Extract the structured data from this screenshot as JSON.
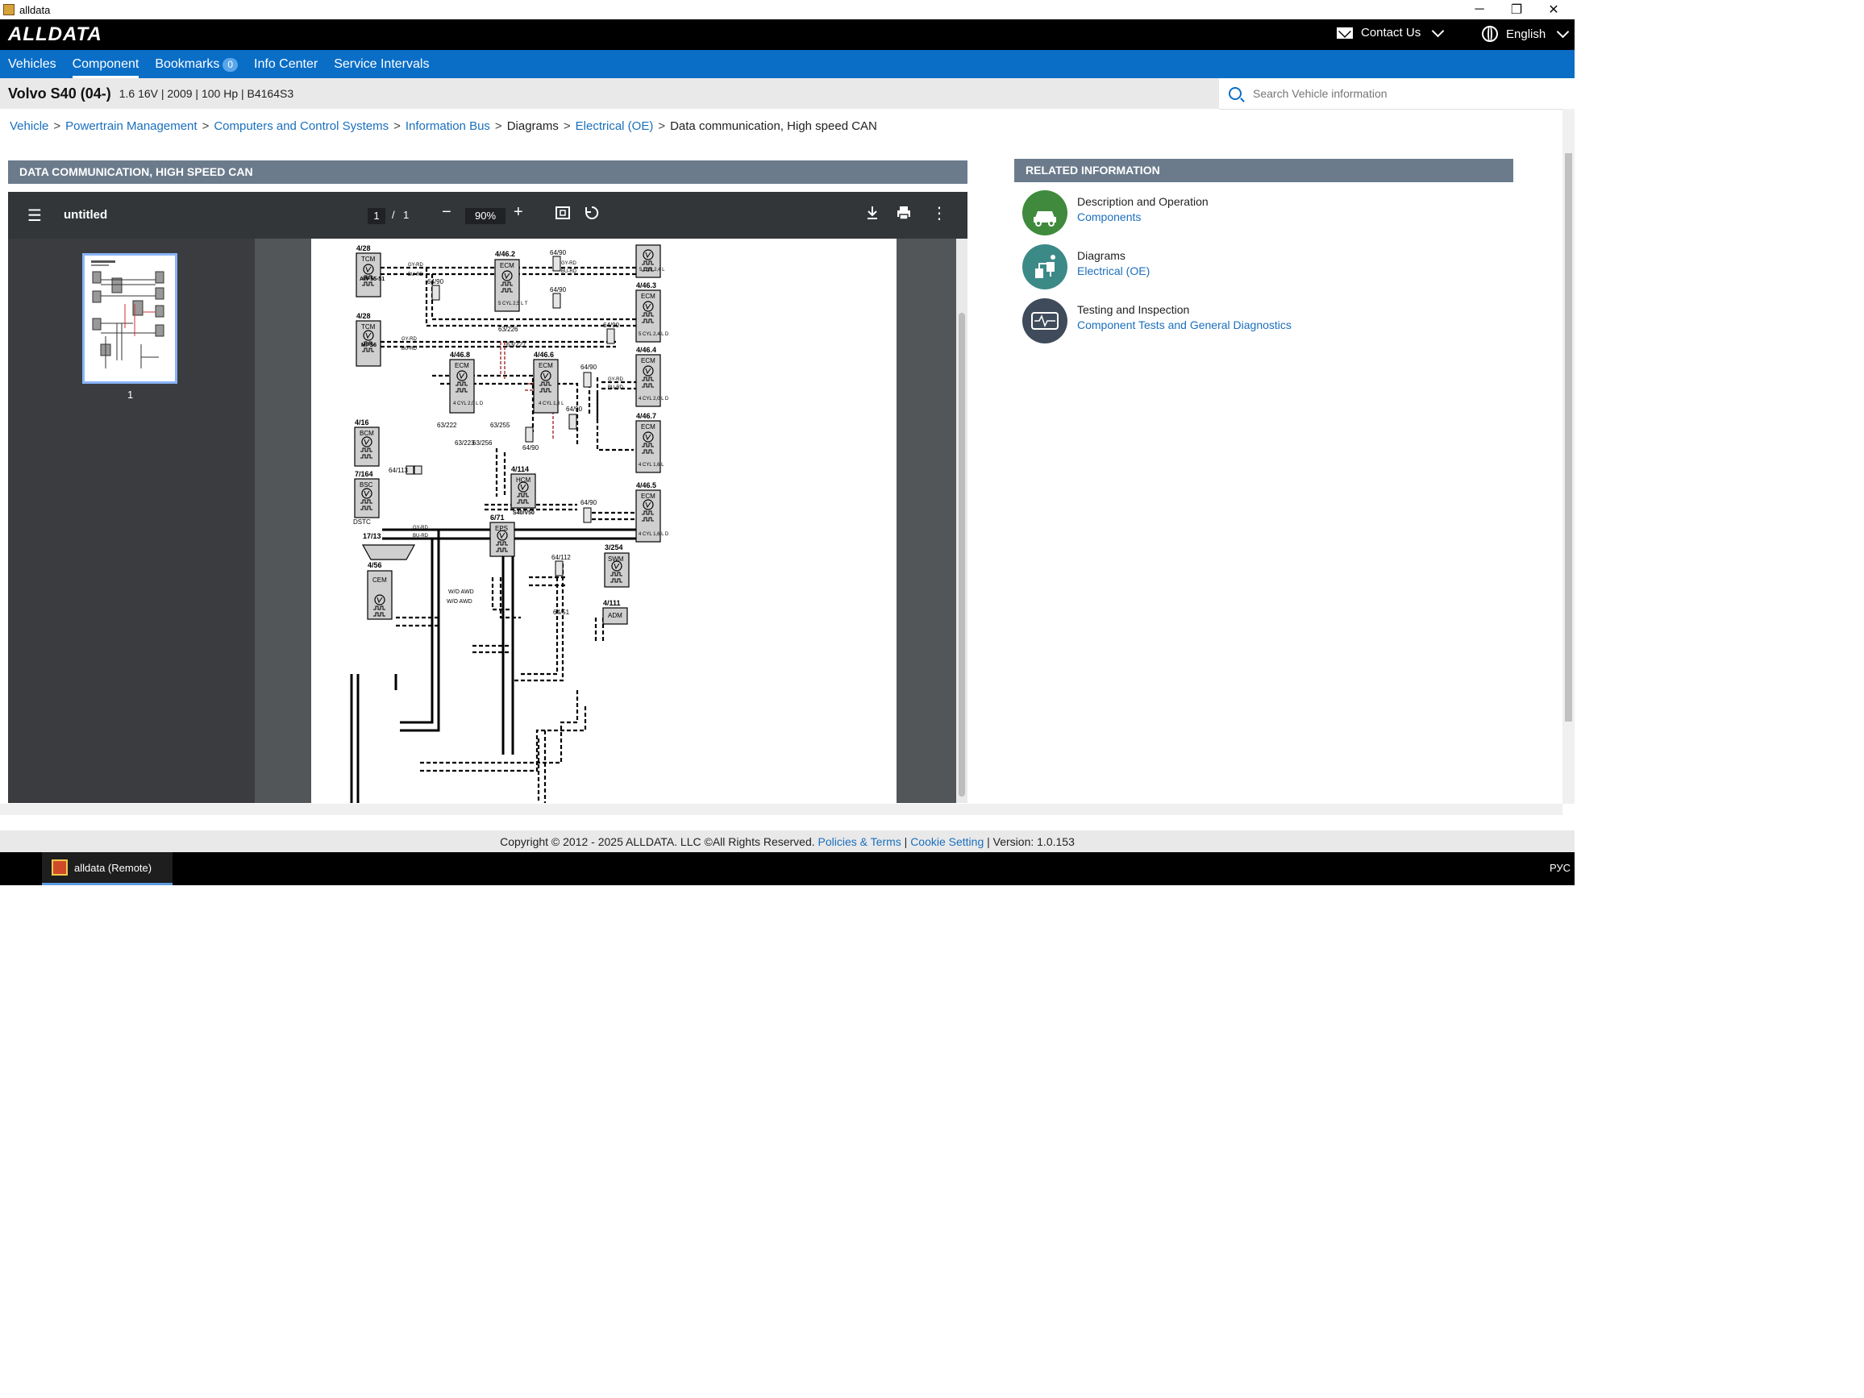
{
  "window": {
    "title": "alldata",
    "minimize": "─",
    "restore": "❐",
    "close": "✕"
  },
  "header": {
    "logo": "ALLDATA",
    "contact_label": "Contact Us",
    "language_label": "English"
  },
  "nav": {
    "items": [
      "Vehicles",
      "Component",
      "Bookmarks",
      "Info Center",
      "Service Intervals"
    ],
    "active": "Component",
    "bookmarks_count": "0"
  },
  "vehicle": {
    "name": "Volvo S40 (04-)",
    "specs": "1.6 16V | 2009 | 100 Hp | B4164S3"
  },
  "search": {
    "placeholder": "Search Vehicle information"
  },
  "breadcrumb": {
    "links": [
      "Vehicle",
      "Powertrain Management",
      "Computers and Control Systems",
      "Information Bus"
    ],
    "plain": "Diagrams",
    "link_last": "Electrical (OE)",
    "current": "Data communication, High speed CAN",
    "separator": ">"
  },
  "diagram": {
    "section_title": "DATA COMMUNICATION, HIGH SPEED CAN",
    "viewer": {
      "doc_title": "untitled",
      "page_current": "1",
      "page_sep": "/",
      "page_total": "1",
      "zoom": "90%",
      "thumbnail_label": "1"
    },
    "labels": {
      "tcm1_id": "4/28",
      "tcm1_name": "TCM",
      "tcm1_sub": "AW 55-51",
      "tcm2_id": "4/28",
      "tcm2_name": "TCM",
      "tcm2_sub": "MPS6",
      "ecm462_id": "4/46.2",
      "ecm462_name": "ECM",
      "ecm462_sub": "5 CYL 2,5 L T",
      "ecm463_id": "4/46.3",
      "ecm463_name": "ECM",
      "ecm463_sub": "5 CYL 2,4 L D",
      "ecm5cyl_sub": "5 CYL 2,4 L",
      "ecm468_id": "4/46.8",
      "ecm468_name": "ECM",
      "ecm468_sub": "4 CYL 2,0 L D",
      "ecm466_id": "4/46.6",
      "ecm466_name": "ECM",
      "ecm466_sub": "4 CYL 1,8 L",
      "ecm464_id": "4/46.4",
      "ecm464_name": "ECM",
      "ecm464_sub": "4 CYL 2,0 L D",
      "ecm467_id": "4/46.7",
      "ecm467_name": "ECM",
      "ecm467_sub": "4 CYL 1,6 L",
      "ecm465_id": "4/46.5",
      "ecm465_name": "ECM",
      "ecm465_sub": "4 CYL 1,6 L D",
      "bcm_id": "4/16",
      "bcm_name": "BCM",
      "bsc_id": "7/164",
      "bsc_name": "BSC",
      "bsc_sub": "DSTC",
      "hcm_id": "4/114",
      "hcm_name": "HCM",
      "hcm_sub": "S40/V50",
      "eps_id": "6/71",
      "eps_name": "EPS",
      "dlc_id": "17/13",
      "cem_id": "4/56",
      "cem_name": "CEM",
      "swm_id": "3/254",
      "swm_name": "SWM",
      "adm_id": "4/111",
      "adm_name": "ADM",
      "c6490": "64/90",
      "c63226": "63/226",
      "c63227": "63/227",
      "c63222": "63/222",
      "c63223": "63/223",
      "c63255": "63/255",
      "c63256": "63/256",
      "c64113": "64/113",
      "c63215": "63/215",
      "c63216": "63/216",
      "c64112": "64/112",
      "c6451": "64/51",
      "w_gyrd": "GY-RD",
      "w_burd": "BU-RD",
      "w_awd": "W/O AWD"
    }
  },
  "related": {
    "title": "RELATED INFORMATION",
    "items": [
      {
        "title": "Description and Operation",
        "link": "Components",
        "color": "#3f8a3c"
      },
      {
        "title": "Diagrams",
        "link": "Electrical (OE)",
        "color": "#3c8a87"
      },
      {
        "title": "Testing and Inspection",
        "link": "Component Tests and General Diagnostics",
        "color": "#3f4a5a"
      }
    ]
  },
  "footer": {
    "copyright": "Copyright © 2012 - 2025 ALLDATA. LLC ©All Rights Reserved.",
    "policies": "Policies & Terms",
    "sep1": "|",
    "cookie": "Cookie Setting",
    "sep2": "|",
    "version": "Version: 1.0.153"
  },
  "taskbar": {
    "app_label": "alldata (Remote)",
    "lang": "РУС"
  }
}
